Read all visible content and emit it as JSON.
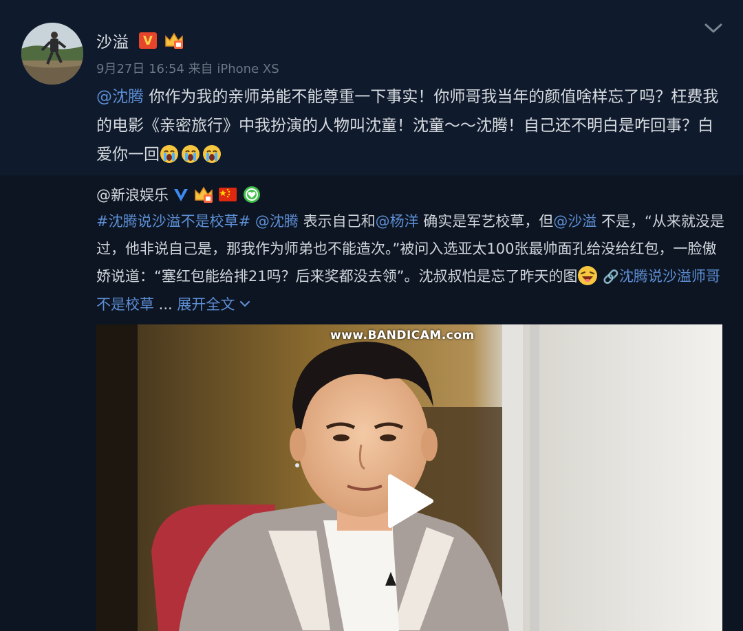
{
  "post": {
    "username": "沙溢",
    "verified_badge": "V",
    "timestamp": "9月27日 16:54",
    "source": "来自 iPhone XS",
    "mention": "@沈腾",
    "text": "你作为我的亲师弟能不能尊重一下事实！你师哥我当年的颜值啥样忘了吗？枉费我的电影《亲密旅行》中我扮演的人物叫沈童！沈童～～沈腾！自己还不明白是咋回事？白爱你一回",
    "emojis": [
      "crying-face-icon",
      "crying-face-icon",
      "crying-face-icon"
    ]
  },
  "repost": {
    "author": "@新浪娱乐",
    "hashtag": "#沈腾说沙溢不是校草#",
    "mention_1": "@沈腾",
    "text_1": " 表示自己和",
    "mention_2": "@杨洋",
    "text_2": " 确实是军艺校草，但",
    "mention_3": "@沙溢",
    "text_3": " 不是，“从来就没是过，他非说自己是，那我作为师弟也不能造次。”被问入选亚太100张最帅面孔给没给红包，一脸傲娇说道：“塞红包能给排21吗？后来奖都没去领”。沈叔叔怕是忘了昨天的图",
    "link_text": "沈腾说沙溢师哥不是校草",
    "ellipsis": " ... ",
    "expand_label": "展开全文"
  },
  "video": {
    "watermark": "www.BANDICAM.com"
  },
  "colors": {
    "background": "#0e1624",
    "link": "#5d8fd6",
    "text": "#d7dbe0",
    "meta": "#6c7684"
  }
}
